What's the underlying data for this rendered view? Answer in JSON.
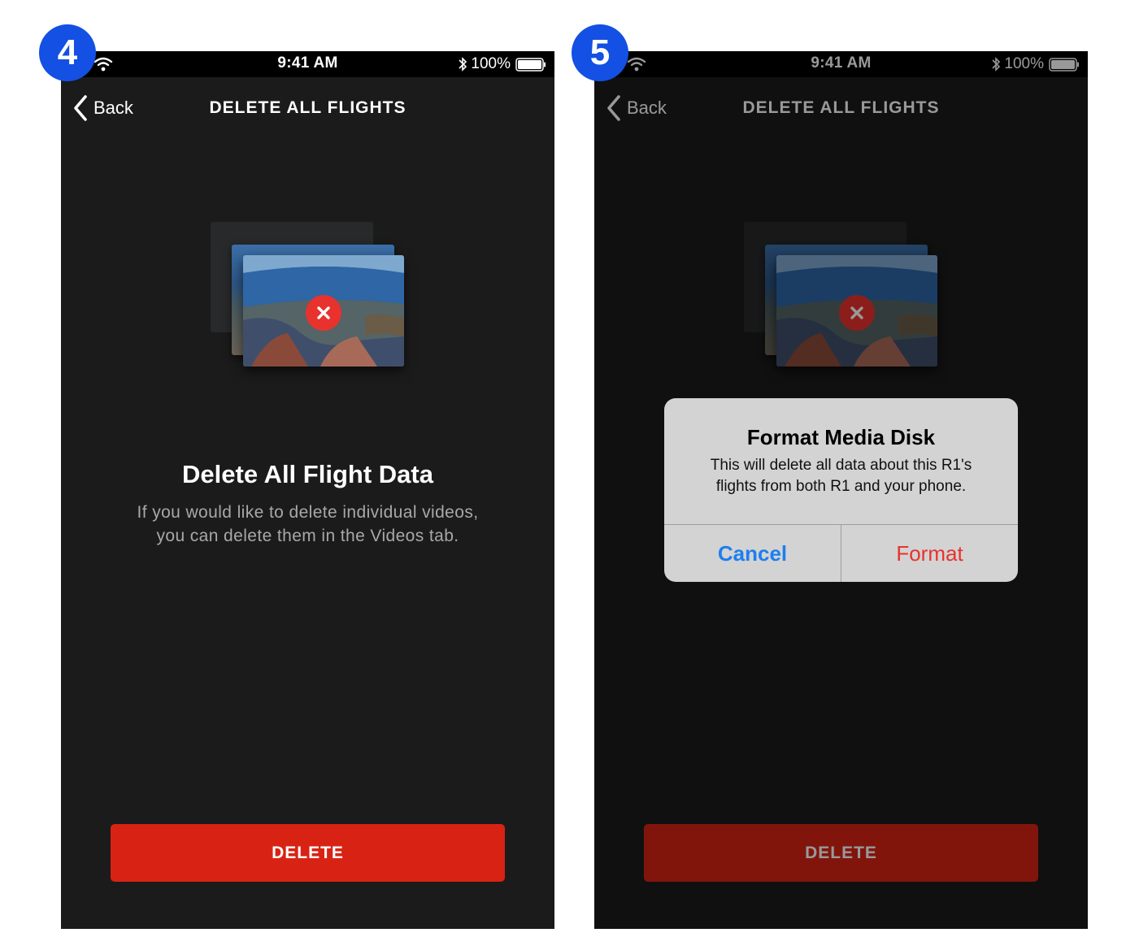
{
  "colors": {
    "screen_bg": "#1b1b1b",
    "delete_red": "#d82314",
    "step_badge_blue": "#1350e3",
    "alert_cancel_blue": "#1c7ff0",
    "alert_format_red": "#e8322e"
  },
  "step4": {
    "badge": "4",
    "status_bar": {
      "time": "9:41 AM",
      "battery": "100%"
    },
    "nav": {
      "back_label": "Back",
      "title": "DELETE ALL FLIGHTS"
    },
    "illustration_icon": "delete-x-icon",
    "headline": "Delete All Flight Data",
    "subtext_line1": "If you would like to delete individual videos,",
    "subtext_line2": "you can delete them in the Videos tab.",
    "delete_button": "DELETE"
  },
  "step5": {
    "badge": "5",
    "status_bar": {
      "time": "9:41 AM",
      "battery": "100%"
    },
    "nav": {
      "back_label": "Back",
      "title": "DELETE ALL FLIGHTS"
    },
    "illustration_icon": "delete-x-icon",
    "delete_button": "DELETE",
    "alert": {
      "title": "Format Media Disk",
      "message_line1": "This will delete all data about this R1's",
      "message_line2": "flights from both R1 and your phone.",
      "cancel": "Cancel",
      "confirm": "Format"
    }
  }
}
